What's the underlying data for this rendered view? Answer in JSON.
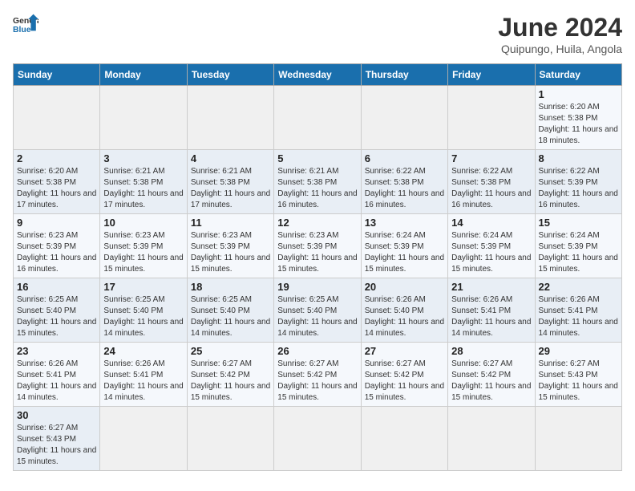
{
  "header": {
    "logo_general": "General",
    "logo_blue": "Blue",
    "month_title": "June 2024",
    "subtitle": "Quipungo, Huila, Angola"
  },
  "weekdays": [
    "Sunday",
    "Monday",
    "Tuesday",
    "Wednesday",
    "Thursday",
    "Friday",
    "Saturday"
  ],
  "weeks": [
    [
      {
        "day": "",
        "sunrise": "",
        "sunset": "",
        "daylight": ""
      },
      {
        "day": "",
        "sunrise": "",
        "sunset": "",
        "daylight": ""
      },
      {
        "day": "",
        "sunrise": "",
        "sunset": "",
        "daylight": ""
      },
      {
        "day": "",
        "sunrise": "",
        "sunset": "",
        "daylight": ""
      },
      {
        "day": "",
        "sunrise": "",
        "sunset": "",
        "daylight": ""
      },
      {
        "day": "",
        "sunrise": "",
        "sunset": "",
        "daylight": ""
      },
      {
        "day": "1",
        "sunrise": "Sunrise: 6:20 AM",
        "sunset": "Sunset: 5:38 PM",
        "daylight": "Daylight: 11 hours and 18 minutes."
      }
    ],
    [
      {
        "day": "2",
        "sunrise": "Sunrise: 6:20 AM",
        "sunset": "Sunset: 5:38 PM",
        "daylight": "Daylight: 11 hours and 17 minutes."
      },
      {
        "day": "3",
        "sunrise": "Sunrise: 6:21 AM",
        "sunset": "Sunset: 5:38 PM",
        "daylight": "Daylight: 11 hours and 17 minutes."
      },
      {
        "day": "4",
        "sunrise": "Sunrise: 6:21 AM",
        "sunset": "Sunset: 5:38 PM",
        "daylight": "Daylight: 11 hours and 17 minutes."
      },
      {
        "day": "5",
        "sunrise": "Sunrise: 6:21 AM",
        "sunset": "Sunset: 5:38 PM",
        "daylight": "Daylight: 11 hours and 16 minutes."
      },
      {
        "day": "6",
        "sunrise": "Sunrise: 6:22 AM",
        "sunset": "Sunset: 5:38 PM",
        "daylight": "Daylight: 11 hours and 16 minutes."
      },
      {
        "day": "7",
        "sunrise": "Sunrise: 6:22 AM",
        "sunset": "Sunset: 5:38 PM",
        "daylight": "Daylight: 11 hours and 16 minutes."
      },
      {
        "day": "8",
        "sunrise": "Sunrise: 6:22 AM",
        "sunset": "Sunset: 5:39 PM",
        "daylight": "Daylight: 11 hours and 16 minutes."
      }
    ],
    [
      {
        "day": "9",
        "sunrise": "Sunrise: 6:23 AM",
        "sunset": "Sunset: 5:39 PM",
        "daylight": "Daylight: 11 hours and 16 minutes."
      },
      {
        "day": "10",
        "sunrise": "Sunrise: 6:23 AM",
        "sunset": "Sunset: 5:39 PM",
        "daylight": "Daylight: 11 hours and 15 minutes."
      },
      {
        "day": "11",
        "sunrise": "Sunrise: 6:23 AM",
        "sunset": "Sunset: 5:39 PM",
        "daylight": "Daylight: 11 hours and 15 minutes."
      },
      {
        "day": "12",
        "sunrise": "Sunrise: 6:23 AM",
        "sunset": "Sunset: 5:39 PM",
        "daylight": "Daylight: 11 hours and 15 minutes."
      },
      {
        "day": "13",
        "sunrise": "Sunrise: 6:24 AM",
        "sunset": "Sunset: 5:39 PM",
        "daylight": "Daylight: 11 hours and 15 minutes."
      },
      {
        "day": "14",
        "sunrise": "Sunrise: 6:24 AM",
        "sunset": "Sunset: 5:39 PM",
        "daylight": "Daylight: 11 hours and 15 minutes."
      },
      {
        "day": "15",
        "sunrise": "Sunrise: 6:24 AM",
        "sunset": "Sunset: 5:39 PM",
        "daylight": "Daylight: 11 hours and 15 minutes."
      }
    ],
    [
      {
        "day": "16",
        "sunrise": "Sunrise: 6:25 AM",
        "sunset": "Sunset: 5:40 PM",
        "daylight": "Daylight: 11 hours and 15 minutes."
      },
      {
        "day": "17",
        "sunrise": "Sunrise: 6:25 AM",
        "sunset": "Sunset: 5:40 PM",
        "daylight": "Daylight: 11 hours and 14 minutes."
      },
      {
        "day": "18",
        "sunrise": "Sunrise: 6:25 AM",
        "sunset": "Sunset: 5:40 PM",
        "daylight": "Daylight: 11 hours and 14 minutes."
      },
      {
        "day": "19",
        "sunrise": "Sunrise: 6:25 AM",
        "sunset": "Sunset: 5:40 PM",
        "daylight": "Daylight: 11 hours and 14 minutes."
      },
      {
        "day": "20",
        "sunrise": "Sunrise: 6:26 AM",
        "sunset": "Sunset: 5:40 PM",
        "daylight": "Daylight: 11 hours and 14 minutes."
      },
      {
        "day": "21",
        "sunrise": "Sunrise: 6:26 AM",
        "sunset": "Sunset: 5:41 PM",
        "daylight": "Daylight: 11 hours and 14 minutes."
      },
      {
        "day": "22",
        "sunrise": "Sunrise: 6:26 AM",
        "sunset": "Sunset: 5:41 PM",
        "daylight": "Daylight: 11 hours and 14 minutes."
      }
    ],
    [
      {
        "day": "23",
        "sunrise": "Sunrise: 6:26 AM",
        "sunset": "Sunset: 5:41 PM",
        "daylight": "Daylight: 11 hours and 14 minutes."
      },
      {
        "day": "24",
        "sunrise": "Sunrise: 6:26 AM",
        "sunset": "Sunset: 5:41 PM",
        "daylight": "Daylight: 11 hours and 14 minutes."
      },
      {
        "day": "25",
        "sunrise": "Sunrise: 6:27 AM",
        "sunset": "Sunset: 5:42 PM",
        "daylight": "Daylight: 11 hours and 15 minutes."
      },
      {
        "day": "26",
        "sunrise": "Sunrise: 6:27 AM",
        "sunset": "Sunset: 5:42 PM",
        "daylight": "Daylight: 11 hours and 15 minutes."
      },
      {
        "day": "27",
        "sunrise": "Sunrise: 6:27 AM",
        "sunset": "Sunset: 5:42 PM",
        "daylight": "Daylight: 11 hours and 15 minutes."
      },
      {
        "day": "28",
        "sunrise": "Sunrise: 6:27 AM",
        "sunset": "Sunset: 5:42 PM",
        "daylight": "Daylight: 11 hours and 15 minutes."
      },
      {
        "day": "29",
        "sunrise": "Sunrise: 6:27 AM",
        "sunset": "Sunset: 5:43 PM",
        "daylight": "Daylight: 11 hours and 15 minutes."
      }
    ],
    [
      {
        "day": "30",
        "sunrise": "Sunrise: 6:27 AM",
        "sunset": "Sunset: 5:43 PM",
        "daylight": "Daylight: 11 hours and 15 minutes."
      },
      {
        "day": "",
        "sunrise": "",
        "sunset": "",
        "daylight": ""
      },
      {
        "day": "",
        "sunrise": "",
        "sunset": "",
        "daylight": ""
      },
      {
        "day": "",
        "sunrise": "",
        "sunset": "",
        "daylight": ""
      },
      {
        "day": "",
        "sunrise": "",
        "sunset": "",
        "daylight": ""
      },
      {
        "day": "",
        "sunrise": "",
        "sunset": "",
        "daylight": ""
      },
      {
        "day": "",
        "sunrise": "",
        "sunset": "",
        "daylight": ""
      }
    ]
  ]
}
